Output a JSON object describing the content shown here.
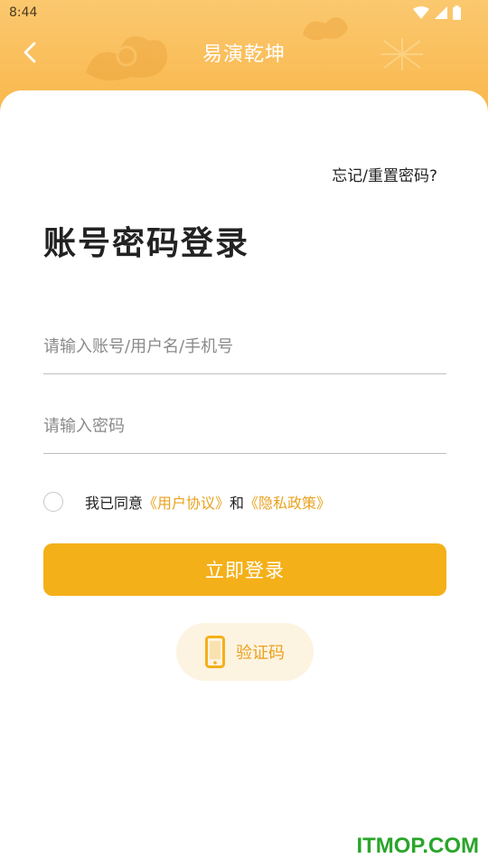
{
  "status_bar": {
    "time": "8:44"
  },
  "header": {
    "title": "易演乾坤"
  },
  "login": {
    "forgot_link": "忘记/重置密码?",
    "title": "账号密码登录",
    "account_placeholder": "请输入账号/用户名/手机号",
    "password_placeholder": "请输入密码",
    "agree_prefix": "我已同意",
    "user_agreement": "《用户协议》",
    "agree_and": "和",
    "privacy_policy": "《隐私政策》",
    "login_button": "立即登录",
    "sms_button": "验证码"
  },
  "watermark": "ITMOP.COM",
  "colors": {
    "accent": "#f4b019",
    "link": "#e9a21e",
    "header_top": "#fbc86f",
    "header_bottom": "#f8b445"
  },
  "icons": {
    "back": "chevron-left-icon",
    "sms": "phone-icon",
    "wifi": "wifi-icon",
    "signal": "signal-icon",
    "battery": "battery-icon"
  }
}
